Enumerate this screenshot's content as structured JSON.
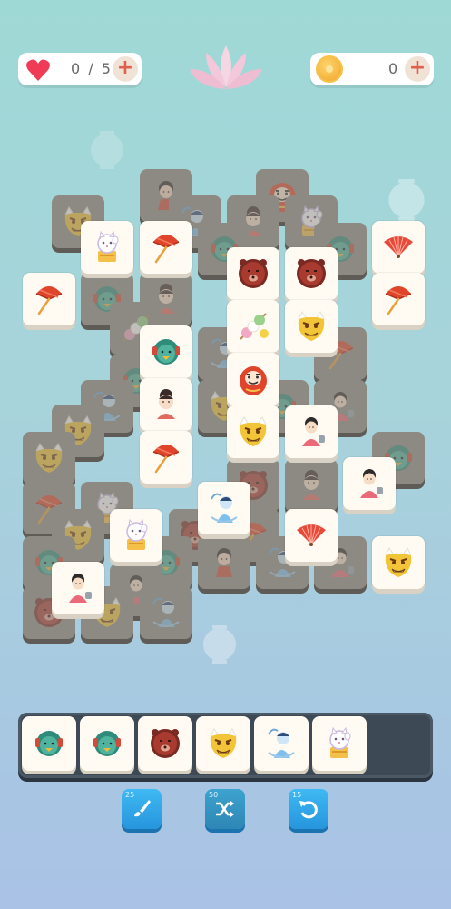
{
  "hud": {
    "lives": {
      "value": "0 / 5",
      "icon": "heart-icon",
      "add_icon": "plus-icon"
    },
    "coins": {
      "value": "0",
      "icon": "coin-icon",
      "add_icon": "plus-icon"
    },
    "emblem": "lotus-icon"
  },
  "board": {
    "tile_types": [
      "lucky-cat",
      "umbrella",
      "fan",
      "kappa",
      "geisha",
      "bear-mask",
      "oni-mask",
      "dango",
      "daruma",
      "yuki-onna",
      "kimono-girl",
      "kintaro"
    ]
  },
  "tray": {
    "slots": [
      "kappa",
      "kappa",
      "bear-mask",
      "oni-mask",
      "yuki-onna",
      "lucky-cat"
    ],
    "capacity": 7
  },
  "powerups": [
    {
      "name": "brush",
      "count": "25",
      "icon": "brush-icon"
    },
    {
      "name": "shuffle",
      "count": "50",
      "icon": "shuffle-icon"
    },
    {
      "name": "undo",
      "count": "15",
      "icon": "undo-icon"
    }
  ],
  "colors": {
    "accent": "#2f9fe8",
    "tray": "#3d4a55",
    "tile": "#fffbf3"
  }
}
